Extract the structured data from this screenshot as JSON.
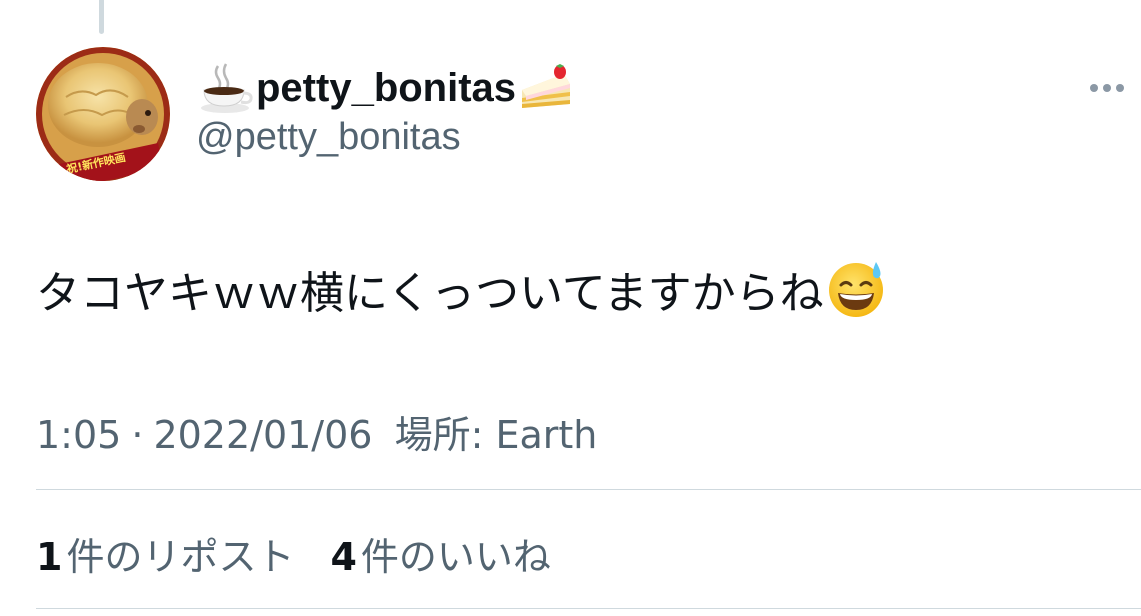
{
  "tweet": {
    "display_name": "petty_bonitas",
    "display_name_prefix_icon": "coffee-icon",
    "display_name_suffix_icon": "shortcake-icon",
    "handle": "@petty_bonitas",
    "avatar_text": "祝!新作映画",
    "text": "タコヤキｗｗ横にくっついてますからね",
    "text_emoji": "grinning-face-with-sweat-icon",
    "time": "1:05",
    "separator": "·",
    "date": "2022/01/06",
    "location_label": "場所: Earth",
    "more_icon": "more-options-icon"
  },
  "stats": {
    "reposts_count": "1",
    "reposts_label": "件のリポスト",
    "likes_count": "4",
    "likes_label": "件のいいね"
  },
  "colors": {
    "text_primary": "#0f1419",
    "text_secondary": "#536471",
    "divider": "#cfd9de"
  }
}
